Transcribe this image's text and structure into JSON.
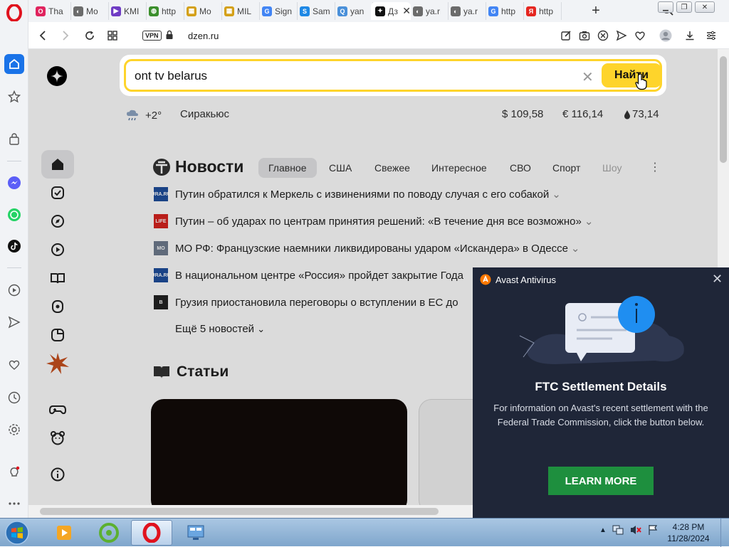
{
  "browser": {
    "tabs": [
      {
        "label": "Tha",
        "favicon": "O",
        "color": "#e0245e"
      },
      {
        "label": "Mo",
        "favicon": "◐",
        "color": "#6b6b6b"
      },
      {
        "label": "KMI",
        "favicon": "▶",
        "color": "#6f3cc4"
      },
      {
        "label": "http",
        "favicon": "◍",
        "color": "#3b8f2c"
      },
      {
        "label": "Mo",
        "favicon": "▦",
        "color": "#d4a017"
      },
      {
        "label": "MIL",
        "favicon": "▦",
        "color": "#d4a017"
      },
      {
        "label": "Sign",
        "favicon": "G",
        "color": "#4285f4"
      },
      {
        "label": "Sam",
        "favicon": "S",
        "color": "#1e88e5"
      },
      {
        "label": "yan",
        "favicon": "Q",
        "color": "#4a90d9"
      },
      {
        "label": "Дз",
        "favicon": "✦",
        "color": "#111111",
        "active": true
      },
      {
        "label": "ya.r",
        "favicon": "◐",
        "color": "#6b6b6b"
      },
      {
        "label": "ya.r",
        "favicon": "◐",
        "color": "#6b6b6b"
      },
      {
        "label": "http",
        "favicon": "G",
        "color": "#4285f4"
      },
      {
        "label": "http",
        "favicon": "Я",
        "color": "#e52620"
      }
    ],
    "vpn_label": "VPN",
    "url": "dzen.ru"
  },
  "search": {
    "query": "ont tv belarus",
    "button_label": "Найти"
  },
  "info_bar": {
    "temperature": "+2°",
    "city": "Сиракьюс",
    "usd": "$ 109,58",
    "eur": "€ 116,14",
    "oil": "73,14"
  },
  "news": {
    "title": "Новости",
    "tabs": [
      "Главное",
      "США",
      "Свежее",
      "Интересное",
      "СВО",
      "Спорт",
      "Шоу"
    ],
    "items": [
      {
        "source": "URA.RU",
        "source_color": "#1f4f9c",
        "text": "Путин обратился к Меркель с извинениями по поводу случая с его собакой"
      },
      {
        "source": "LIFE",
        "source_color": "#d8231f",
        "text": "Путин – об ударах по центрам принятия решений: «В течение дня все возможно»"
      },
      {
        "source": "МО",
        "source_color": "#6f7c8f",
        "text": "МО РФ: Французские наемники ликвидированы ударом «Искандера» в Одессе"
      },
      {
        "source": "URA.RU",
        "source_color": "#1f4f9c",
        "text": "В национальном центре «Россия» пройдет закрытие Года"
      },
      {
        "source": "B",
        "source_color": "#222222",
        "text": "Грузия приостановила переговоры о вступлении в ЕС до"
      }
    ],
    "more_label": "Ещё 5 новостей"
  },
  "articles": {
    "title": "Статьи"
  },
  "avast": {
    "app_name": "Avast Antivirus",
    "title": "FTC Settlement Details",
    "body": "For information on Avast's recent settlement with the Federal Trade Commission, click the button below.",
    "button_label": "LEARN MORE",
    "accent": "#1e8f3e"
  },
  "taskbar": {
    "time": "4:28 PM",
    "date": "11/28/2024"
  }
}
